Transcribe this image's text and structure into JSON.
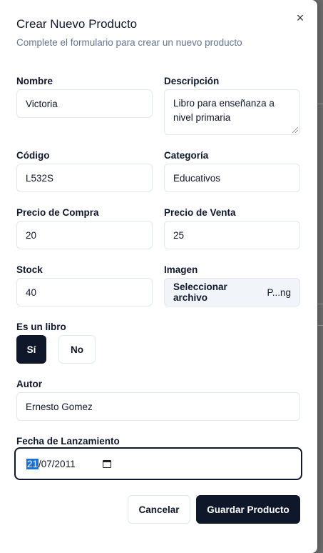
{
  "dialog": {
    "title": "Crear Nuevo Producto",
    "subtitle": "Complete el formulario para crear un nuevo producto",
    "close_icon": "×"
  },
  "fields": {
    "nombre": {
      "label": "Nombre",
      "value": "Victoria"
    },
    "descripcion": {
      "label": "Descripción",
      "value": "Libro para enseñanza a nivel primaria"
    },
    "codigo": {
      "label": "Código",
      "value": "L532S"
    },
    "categoria": {
      "label": "Categoría",
      "value": "Educativos"
    },
    "precio_compra": {
      "label": "Precio de Compra",
      "value": "20"
    },
    "precio_venta": {
      "label": "Precio de Venta",
      "value": "25"
    },
    "stock": {
      "label": "Stock",
      "value": "40"
    },
    "imagen": {
      "label": "Imagen",
      "button": "Seleccionar archivo",
      "filename": "P...ng"
    },
    "es_libro": {
      "label": "Es un libro",
      "yes": "Sí",
      "no": "No",
      "selected": "Sí"
    },
    "autor": {
      "label": "Autor",
      "value": "Ernesto Gomez"
    },
    "fecha": {
      "label": "Fecha de Lanzamiento",
      "day": "21",
      "rest": "/07/2011"
    }
  },
  "actions": {
    "cancel": "Cancelar",
    "save": "Guardar Producto"
  },
  "colors": {
    "primary": "#0f172a",
    "muted": "#64748b",
    "border": "#e2e8f0",
    "selection": "#1d6fd8"
  }
}
